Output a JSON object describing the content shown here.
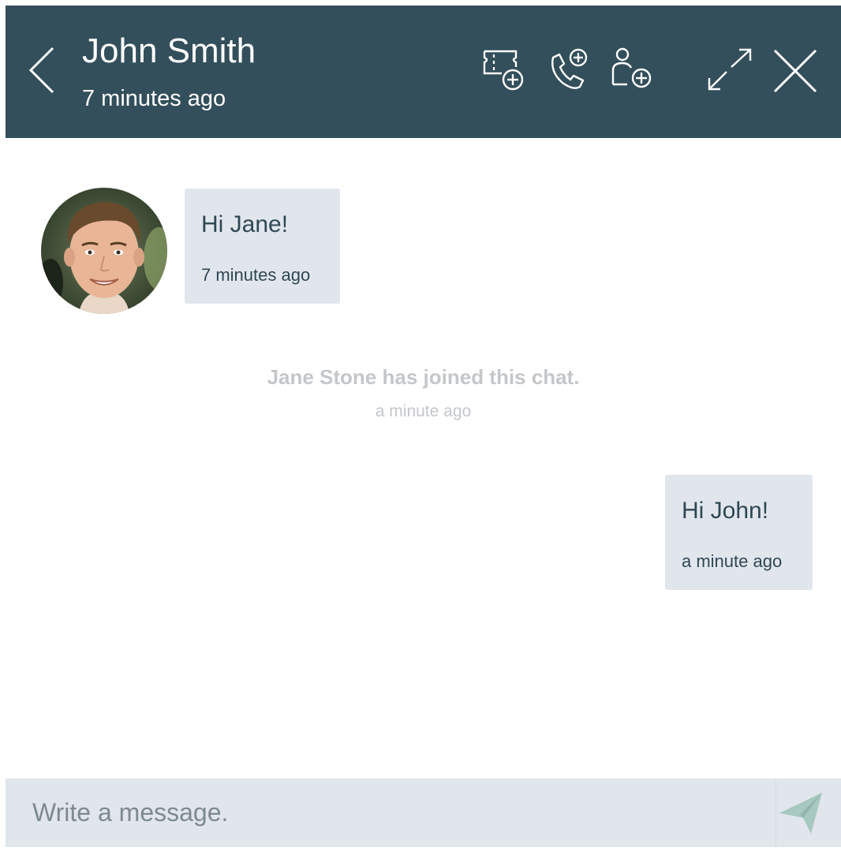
{
  "header": {
    "title": "John Smith",
    "subtitle": "7 minutes ago",
    "background_color": "#334f5b",
    "icons": [
      "back-chevron-icon",
      "create-ticket-icon",
      "call-add-icon",
      "add-participant-icon",
      "expand-icon",
      "close-icon"
    ]
  },
  "messages": [
    {
      "sender": "other",
      "text": "Hi Jane!",
      "time": "7 minutes ago",
      "avatar": "avatar-john-smith"
    },
    {
      "sender": "me",
      "text": "Hi John!",
      "time": "a minute ago"
    }
  ],
  "system_message": {
    "text": "Jane Stone has joined this chat.",
    "time": "a minute ago"
  },
  "composer": {
    "placeholder": "Write a message.",
    "value": "",
    "send_icon": "paper-plane-icon",
    "send_icon_color": "#a7c8bf"
  },
  "colors": {
    "bubble": "#e1e6ed",
    "system_text": "#c4c7ca",
    "text": "#2f4753"
  }
}
